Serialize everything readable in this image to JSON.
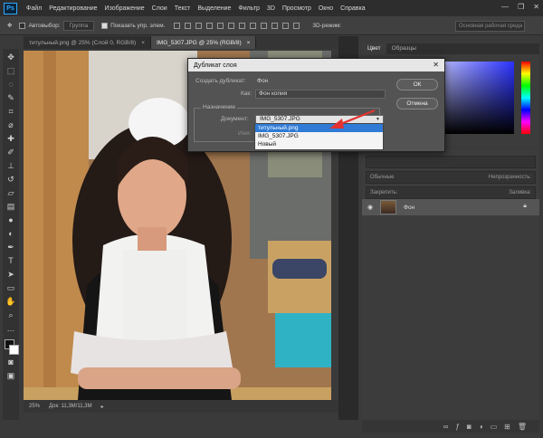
{
  "app": {
    "logo": "Ps",
    "menu": [
      "Файл",
      "Редактирование",
      "Изображение",
      "Слои",
      "Текст",
      "Выделение",
      "Фильтр",
      "3D",
      "Просмотр",
      "Окно",
      "Справка"
    ],
    "window_buttons": [
      "—",
      "❐",
      "✕"
    ]
  },
  "options_bar": {
    "autoselect_label": "Автовыбор:",
    "autoselect_value": "Группа",
    "show_controls_label": "Показать упр. элем.",
    "mode_3d_label": "3D-режим:",
    "workspace_value": "Основная рабочая среда"
  },
  "tabs": [
    {
      "label": "титульный.png @ 25% (Слой 0, RGB/8)",
      "close": "×"
    },
    {
      "label": "IMG_5307.JPG @ 25% (RGB/8)",
      "close": "×"
    }
  ],
  "status_bar": {
    "zoom": "25%",
    "doc_info": "Док: 11,3M/11,3M"
  },
  "color_panel": {
    "tabs": [
      "Цвет",
      "Образцы"
    ],
    "hue_color": "#2b33ff"
  },
  "layers_panel": {
    "blend_mode": "Обычные",
    "opacity_label": "Непрозрачность:",
    "lock_label": "Закрепить:",
    "fill_label": "Заливка:",
    "layer_name": "Фон"
  },
  "dialog": {
    "title": "Дубликат слоя",
    "close": "✕",
    "duplicate_label": "Создать дубликат:",
    "duplicate_value": "Фон",
    "as_label": "Как:",
    "as_value": "Фон копия",
    "destination_legend": "Назначение",
    "document_label": "Документ:",
    "document_value": "IMG_5307.JPG",
    "name_label": "Имя:",
    "ok": "ОК",
    "cancel": "Отмена",
    "dropdown_items": [
      "титульный.png",
      "IMG_5307.JPG",
      "Новый"
    ],
    "highlighted_index": 0
  },
  "annotation": {
    "arrow_color": "#e23232"
  }
}
